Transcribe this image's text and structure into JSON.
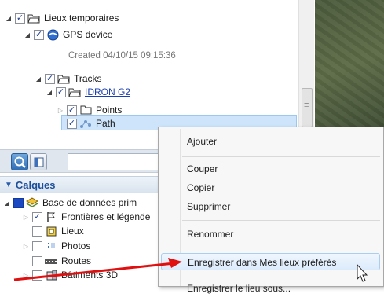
{
  "places": {
    "lieux_temporaires": "Lieux temporaires",
    "gps_device": "GPS device",
    "created": "Created 04/10/15 09:15:36",
    "tracks": "Tracks",
    "idron": "IDRON G2",
    "points": "Points",
    "path": "Path"
  },
  "search": {
    "value": ""
  },
  "calques": {
    "title": "Calques",
    "items": [
      "Base de données prim",
      "Frontières et légende",
      "Lieux",
      "Photos",
      "Routes",
      "Bâtiments 3D"
    ]
  },
  "context_menu": {
    "items": [
      "Ajouter",
      "Couper",
      "Copier",
      "Supprimer",
      "Renommer",
      "Enregistrer dans Mes lieux préférés",
      "Enregistrer le lieu sous..."
    ]
  },
  "colors": {
    "highlight": "#cde4fb",
    "link": "#1b3fb0",
    "annotation_arrow": "#e01010"
  }
}
